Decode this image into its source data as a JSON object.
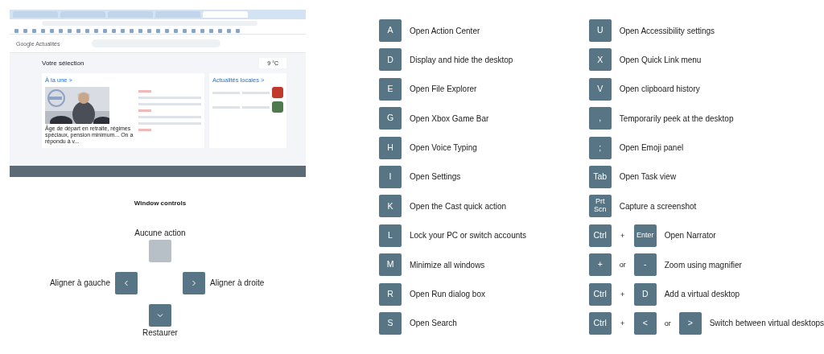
{
  "screenshot": {
    "tabs": [
      {
        "selected": false
      },
      {
        "selected": false
      },
      {
        "selected": false
      },
      {
        "selected": false
      },
      {
        "selected": true
      }
    ],
    "brand": "Google Actualités",
    "title": "Votre sélection",
    "weather": "9 °C",
    "top_heading": "À la une >",
    "local_heading": "Actualités locales >",
    "headline": "Âge de départ en retraite, régimes spéciaux, pension minimum... On a répondu à v..."
  },
  "window_controls": {
    "title": "Window controls",
    "controls": [
      {
        "kind": "up",
        "label": "Aucune action",
        "disabled": true
      },
      {
        "kind": "left",
        "label": "Aligner à gauche",
        "disabled": false
      },
      {
        "kind": "right",
        "label": "Aligner à droite",
        "disabled": false
      },
      {
        "kind": "down",
        "label": "Restaurer",
        "disabled": false
      }
    ]
  },
  "shortcut_columns": [
    [
      {
        "parts": [
          {
            "kind": "key",
            "text": "A"
          }
        ],
        "action": "Open Action Center"
      },
      {
        "parts": [
          {
            "kind": "key",
            "text": "D"
          }
        ],
        "action": "Display and hide the desktop"
      },
      {
        "parts": [
          {
            "kind": "key",
            "text": "E"
          }
        ],
        "action": "Open File Explorer"
      },
      {
        "parts": [
          {
            "kind": "key",
            "text": "G"
          }
        ],
        "action": "Open Xbox Game Bar"
      },
      {
        "parts": [
          {
            "kind": "key",
            "text": "H"
          }
        ],
        "action": "Open Voice Typing"
      },
      {
        "parts": [
          {
            "kind": "key",
            "text": "I"
          }
        ],
        "action": "Open Settings"
      },
      {
        "parts": [
          {
            "kind": "key",
            "text": "K"
          }
        ],
        "action": "Open the Cast quick action"
      },
      {
        "parts": [
          {
            "kind": "key",
            "text": "L"
          }
        ],
        "action": "Lock your PC or switch accounts"
      },
      {
        "parts": [
          {
            "kind": "key",
            "text": "M"
          }
        ],
        "action": "Minimize all windows"
      },
      {
        "parts": [
          {
            "kind": "key",
            "text": "R"
          }
        ],
        "action": "Open Run dialog box"
      },
      {
        "parts": [
          {
            "kind": "key",
            "text": "S"
          }
        ],
        "action": "Open Search"
      }
    ],
    [
      {
        "parts": [
          {
            "kind": "key",
            "text": "U"
          }
        ],
        "action": "Open Accessibility settings"
      },
      {
        "parts": [
          {
            "kind": "key",
            "text": "X"
          }
        ],
        "action": "Open Quick Link menu"
      },
      {
        "parts": [
          {
            "kind": "key",
            "text": "V"
          }
        ],
        "action": "Open clipboard history"
      },
      {
        "parts": [
          {
            "kind": "key",
            "text": ","
          }
        ],
        "action": "Temporarily peek at the desktop"
      },
      {
        "parts": [
          {
            "kind": "key",
            "text": ";"
          }
        ],
        "action": "Open Emoji panel"
      },
      {
        "parts": [
          {
            "kind": "key",
            "text": "Tab"
          }
        ],
        "action": "Open Task view"
      },
      {
        "parts": [
          {
            "kind": "key",
            "text": "Prt Scn"
          }
        ],
        "action": "Capture a screenshot"
      },
      {
        "parts": [
          {
            "kind": "key",
            "text": "Ctrl"
          },
          {
            "kind": "sep",
            "text": "+"
          },
          {
            "kind": "key",
            "text": "Enter"
          }
        ],
        "action": "Open Narrator"
      },
      {
        "parts": [
          {
            "kind": "key",
            "text": "+"
          },
          {
            "kind": "sep",
            "text": "or"
          },
          {
            "kind": "key",
            "text": "-"
          }
        ],
        "action": "Zoom using magnifier"
      },
      {
        "parts": [
          {
            "kind": "key",
            "text": "Ctrl"
          },
          {
            "kind": "sep",
            "text": "+"
          },
          {
            "kind": "key",
            "text": "D"
          }
        ],
        "action": "Add a virtual desktop"
      },
      {
        "parts": [
          {
            "kind": "key",
            "text": "Ctrl"
          },
          {
            "kind": "sep",
            "text": "+"
          },
          {
            "kind": "key",
            "text": "<"
          },
          {
            "kind": "sep",
            "text": "or"
          },
          {
            "kind": "key",
            "text": ">"
          }
        ],
        "action": "Switch between virtual desktops"
      }
    ]
  ]
}
